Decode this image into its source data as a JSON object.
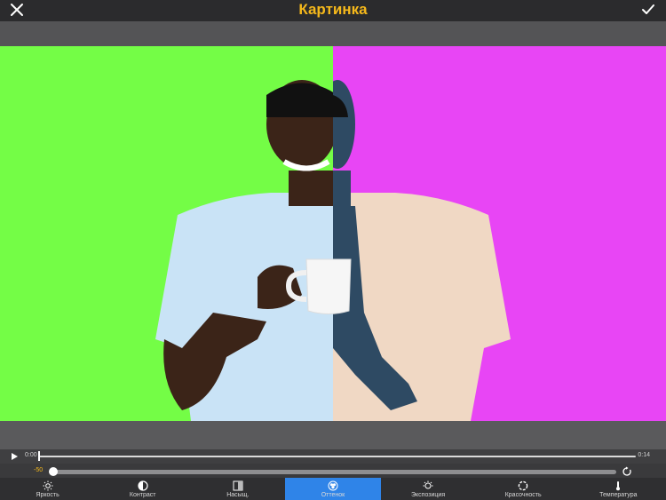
{
  "header": {
    "title": "Картинка",
    "close_icon": "close-icon",
    "confirm_icon": "checkmark-icon"
  },
  "colors": {
    "accent": "#f5b81b",
    "active_tool": "#2f84e8",
    "bg_left": "#74fd46",
    "bg_right": "#e845f5"
  },
  "video": {
    "time_start": "0:00",
    "time_end": "0:14",
    "progress": 0.0
  },
  "adjust": {
    "value_label": "-50",
    "value": -50,
    "reset_icon": "reset-icon"
  },
  "tools": [
    {
      "label": "Яркость",
      "icon": "sun-icon",
      "active": false
    },
    {
      "label": "Контраст",
      "icon": "contrast-icon",
      "active": false
    },
    {
      "label": "Насыщ.",
      "icon": "saturation-icon",
      "active": false
    },
    {
      "label": "Оттенок",
      "icon": "hue-icon",
      "active": true
    },
    {
      "label": "Экспозиция",
      "icon": "exposure-icon",
      "active": false
    },
    {
      "label": "Красочность",
      "icon": "vibrance-icon",
      "active": false
    },
    {
      "label": "Температура",
      "icon": "thermometer-icon",
      "active": false
    }
  ]
}
